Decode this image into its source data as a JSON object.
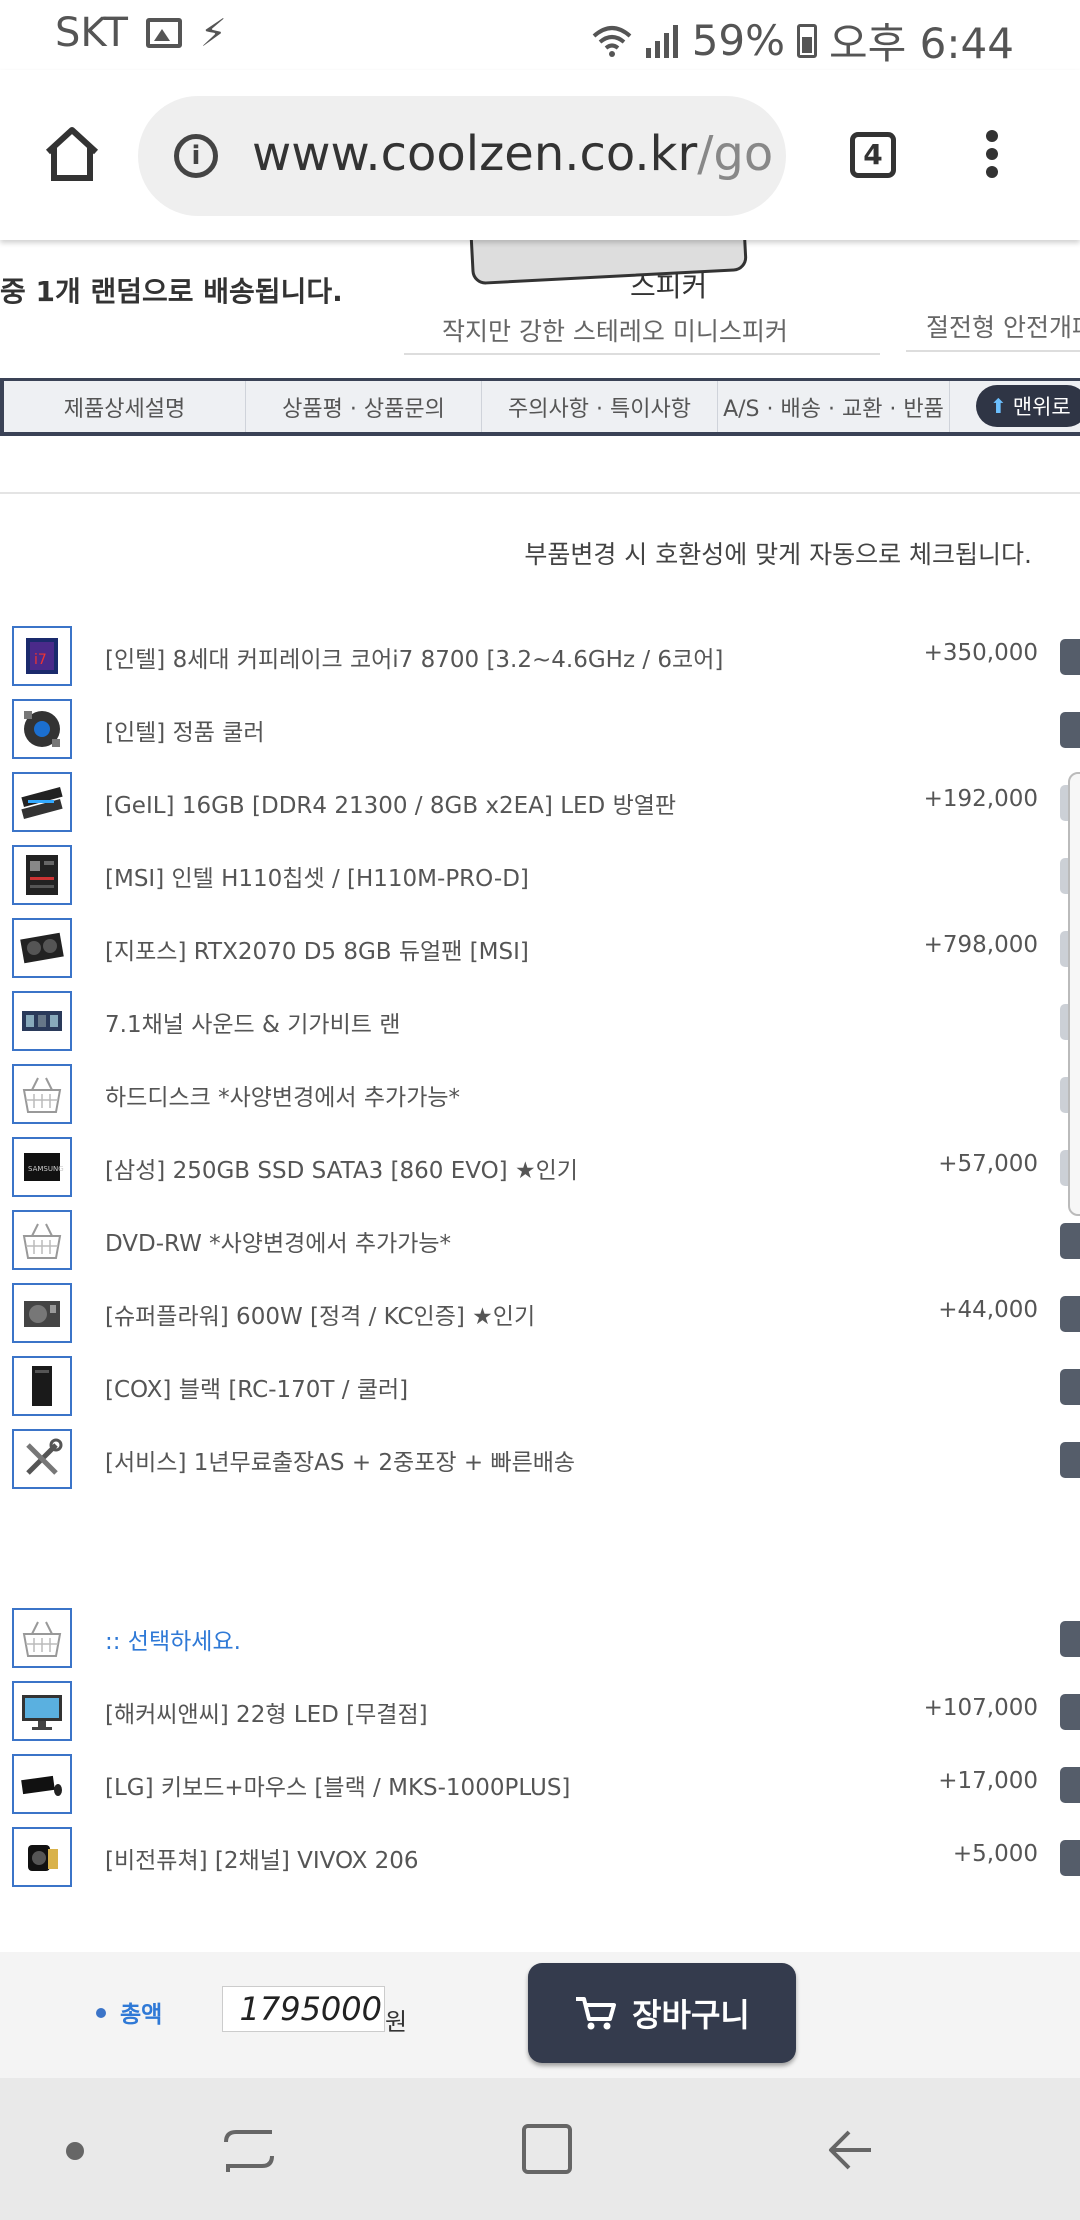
{
  "status_bar": {
    "carrier": "SKT",
    "battery": "59%",
    "time": "오후 6:44"
  },
  "browser": {
    "url_main": "www.coolzen.co.kr",
    "url_rest": "/goo",
    "tab_count": "4"
  },
  "banner": {
    "left_text": "중 1개 랜덤으로 배송됩니다.",
    "product_name": "스피커",
    "product_desc": "작지만 강한 스테레오 미니스피커",
    "product2_desc": "절전형 안전개폐"
  },
  "tabs": [
    "제품상세설명",
    "상품평 · 상품문의",
    "주의사항 · 특이사항",
    "A/S · 배송 · 교환 · 반품"
  ],
  "top_button_label": "맨위로",
  "notice": "부품변경 시 호환성에 맞게 자동으로 체크됩니다.",
  "components": [
    {
      "icon": "cpu-icon",
      "name": "[인텔] 8세대 커피레이크 코어i7 8700 [3.2~4.6GHz / 6코어]",
      "price": "+350,000"
    },
    {
      "icon": "cooler-icon",
      "name": "[인텔] 정품 쿨러",
      "price": ""
    },
    {
      "icon": "ram-icon",
      "name": "[GeIL] 16GB [DDR4 21300 / 8GB x2EA] LED 방열판",
      "price": "+192,000"
    },
    {
      "icon": "motherboard-icon",
      "name": "[MSI] 인텔 H110칩셋 / [H110M-PRO-D]",
      "price": ""
    },
    {
      "icon": "gpu-icon",
      "name": "[지포스] RTX2070 D5 8GB 듀얼팬 [MSI]",
      "price": "+798,000"
    },
    {
      "icon": "sound-lan-icon",
      "name": "7.1채널 사운드 & 기가비트 랜",
      "price": ""
    },
    {
      "icon": "basket-icon",
      "name": "하드디스크 *사양변경에서 추가가능*",
      "price": ""
    },
    {
      "icon": "ssd-icon",
      "name": "[삼성] 250GB SSD SATA3 [860 EVO] ★인기",
      "price": "+57,000"
    },
    {
      "icon": "basket-icon",
      "name": "DVD-RW *사양변경에서 추가가능*",
      "price": ""
    },
    {
      "icon": "psu-icon",
      "name": "[슈퍼플라워] 600W [정격 / KC인증] ★인기",
      "price": "+44,000"
    },
    {
      "icon": "case-icon",
      "name": "[COX] 블랙 [RC-170T / 쿨러]",
      "price": ""
    },
    {
      "icon": "tools-icon",
      "name": "[서비스] 1년무료출장AS + 2중포장 + 빠른배송",
      "price": ""
    }
  ],
  "peripherals": [
    {
      "icon": "basket-icon",
      "name": ":: 선택하세요.",
      "price": ""
    },
    {
      "icon": "monitor-icon",
      "name": "[해커씨앤씨] 22형 LED [무결점]",
      "price": "+107,000"
    },
    {
      "icon": "keyboard-icon",
      "name": "[LG] 키보드+마우스 [블랙 / MKS-1000PLUS]",
      "price": "+17,000"
    },
    {
      "icon": "speaker-icon",
      "name": "[비전퓨쳐] [2채널] VIVOX 206",
      "price": "+5,000"
    }
  ],
  "total": {
    "label": "총액",
    "value": "1795000",
    "unit": "원"
  },
  "cart_button_label": "장바구니"
}
